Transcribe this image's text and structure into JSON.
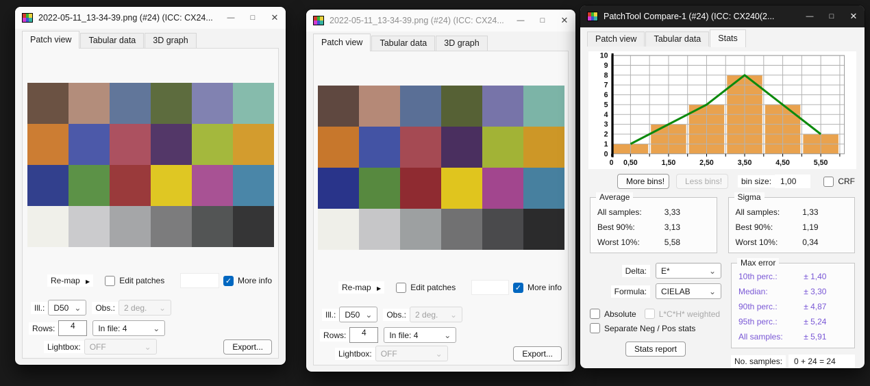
{
  "glyphs": {
    "minimize": "—",
    "maximize": "□",
    "close": "✕",
    "chevron_down": "⌄",
    "arrow_right": "▶",
    "check": "✓"
  },
  "app_icon_colors": [
    "#d03a2b",
    "#35b234",
    "#e8d23c",
    "#d23ad2",
    "#3a57d0",
    "#35b2a0"
  ],
  "patch_controls": {
    "remap": "Re-map",
    "edit_patches": "Edit patches",
    "edit_patches_checked": false,
    "more_info": "More info",
    "more_info_checked": true,
    "ill_label": "Ill.:",
    "ill_value": "D50",
    "obs_label": "Obs.:",
    "obs_value": "2 deg.",
    "rows_label": "Rows:",
    "rows_value": "4",
    "in_file_value": "In file: 4",
    "lightbox_label": "Lightbox:",
    "lightbox_value": "OFF",
    "export": "Export..."
  },
  "window1": {
    "title": "2022-05-11_13-34-39.png (#24) (ICC: CX24...",
    "tabs": [
      "Patch view",
      "Tabular data",
      "3D graph"
    ],
    "patches": [
      "#6B5243",
      "#B38D7B",
      "#61769A",
      "#5D6C3E",
      "#8182B1",
      "#86BBAC",
      "#CC7D33",
      "#4C59A9",
      "#AC5160",
      "#533768",
      "#A4B83D",
      "#D39C2E",
      "#32408D",
      "#5C9247",
      "#9A3A3B",
      "#DFC723",
      "#A85294",
      "#4A86A8",
      "#F0F0EA",
      "#CBCBCD",
      "#A5A6A8",
      "#7C7C7D",
      "#535555",
      "#353536"
    ]
  },
  "window2": {
    "title": "2022-05-11_13-34-39.png (#24) (ICC: CX24...",
    "tabs": [
      "Patch view",
      "Tabular data",
      "3D graph"
    ],
    "patches": [
      "#5F4840",
      "#B58977",
      "#5A6F96",
      "#566135",
      "#7774A9",
      "#7CB4A7",
      "#C7772C",
      "#4353A4",
      "#A54A53",
      "#4A2F5F",
      "#A2B336",
      "#CD9727",
      "#29348A",
      "#57893F",
      "#8F2B31",
      "#E0C51E",
      "#A2468E",
      "#47809F",
      "#EFEFE9",
      "#C6C6C8",
      "#9DA0A1",
      "#717172",
      "#4A4A4C",
      "#2B2B2C"
    ]
  },
  "window3": {
    "title": "PatchTool Compare-1 (#24) (ICC: CX240(2...",
    "tabs": [
      "Patch view",
      "Tabular data",
      "Stats"
    ],
    "histogram_controls": {
      "more_bins": "More bins!",
      "less_bins": "Less bins!",
      "bin_size_label": "bin size:",
      "bin_size_value": "1,00",
      "crf": "CRF",
      "crf_checked": false
    },
    "average": {
      "title": "Average",
      "rows": [
        {
          "label": "All samples:",
          "value": "3,33"
        },
        {
          "label": "Best 90%:",
          "value": "3,13"
        },
        {
          "label": "Worst 10%:",
          "value": "5,58"
        }
      ]
    },
    "sigma": {
      "title": "Sigma",
      "rows": [
        {
          "label": "All samples:",
          "value": "1,33"
        },
        {
          "label": "Best 90%:",
          "value": "1,19"
        },
        {
          "label": "Worst 10%:",
          "value": "0,34"
        }
      ]
    },
    "max_error": {
      "title": "Max error",
      "rows": [
        {
          "label": "10th perc.:",
          "value": "± 1,40"
        },
        {
          "label": "Median:",
          "value": "± 3,30"
        },
        {
          "label": "90th perc.:",
          "value": "± 4,87"
        },
        {
          "label": "95th perc.:",
          "value": "± 5,24"
        },
        {
          "label": "All samples:",
          "value": "± 5,91"
        }
      ]
    },
    "delta_label": "Delta:",
    "delta_value": "E*",
    "formula_label": "Formula:",
    "formula_value": "CIELAB",
    "absolute": "Absolute",
    "absolute_checked": false,
    "lch_weighted": "L*C*H* weighted",
    "lch_weighted_checked": false,
    "separate": "Separate Neg / Pos stats",
    "separate_checked": false,
    "stats_report": "Stats report",
    "no_samples_label": "No. samples:",
    "no_samples_value": "0 + 24 = 24"
  },
  "chart_data": {
    "type": "bar",
    "title": "Delta E* histogram",
    "bin_edges": [
      0,
      1,
      2,
      3,
      4,
      5,
      6
    ],
    "counts": [
      1,
      3,
      5,
      8,
      5,
      2
    ],
    "line_series": {
      "name": "frequency polygon",
      "x": [
        0.5,
        1.5,
        2.5,
        3.5,
        4.5,
        5.5
      ],
      "y": [
        1,
        3,
        5,
        8,
        5,
        2
      ]
    },
    "x_ticks": [
      {
        "x": 0,
        "label": "0"
      },
      {
        "x": 0.5,
        "label": "0,50"
      },
      {
        "x": 1.5,
        "label": "1,50"
      },
      {
        "x": 2.5,
        "label": "2,50"
      },
      {
        "x": 3.5,
        "label": "3,50"
      },
      {
        "x": 4.5,
        "label": "4,50"
      },
      {
        "x": 5.5,
        "label": "5,50"
      }
    ],
    "y_ticks": [
      "0",
      "1",
      "2",
      "3",
      "4",
      "5",
      "6",
      "7",
      "8",
      "9",
      "10"
    ],
    "xlim": [
      0,
      6.12
    ],
    "ylim": [
      0,
      10
    ],
    "x_grid_step": 0.5,
    "grid": true,
    "legend": "none",
    "bar_color": "#E9A24E",
    "line_color": "#0C8A0C",
    "grid_color": "#b3b3b3",
    "axis_color": "#000000"
  }
}
